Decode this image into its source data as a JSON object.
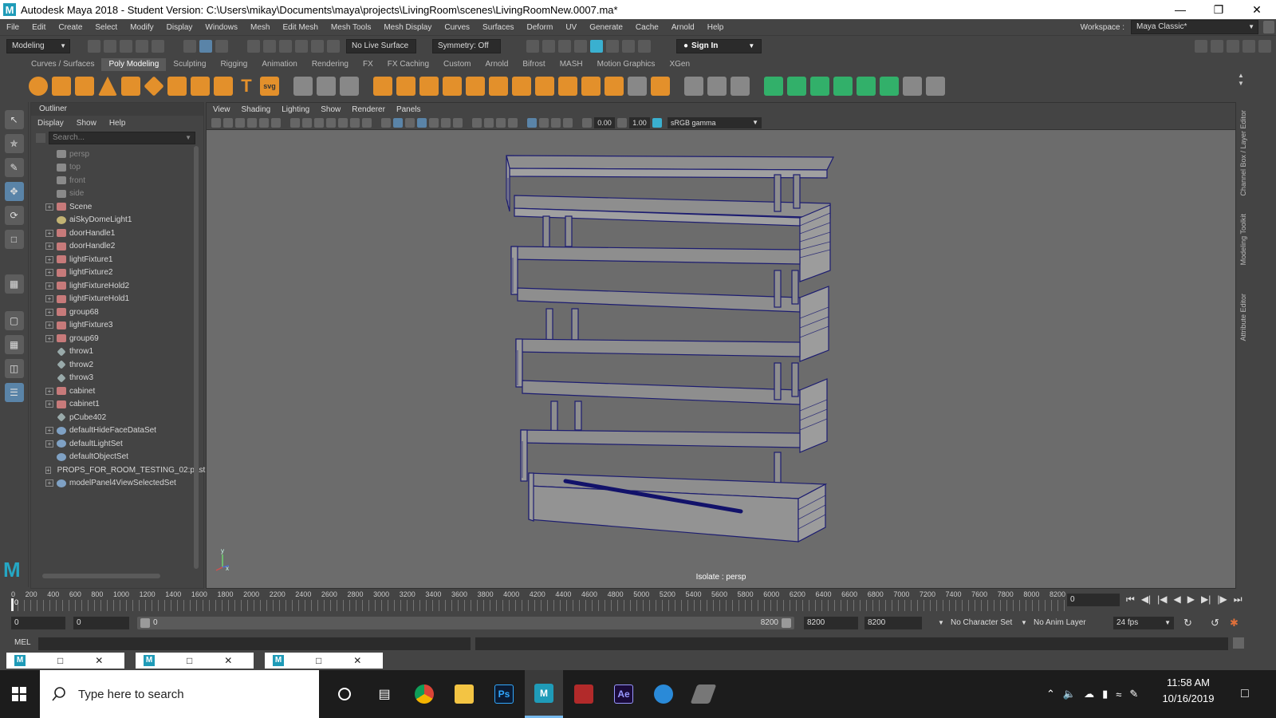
{
  "window": {
    "title": "Autodesk Maya 2018 - Student Version: C:\\Users\\mikay\\Documents\\maya\\projects\\LivingRoom\\scenes\\LivingRoomNew.0007.ma*",
    "logo": "M"
  },
  "menubar": [
    "File",
    "Edit",
    "Create",
    "Select",
    "Modify",
    "Display",
    "Windows",
    "Mesh",
    "Edit Mesh",
    "Mesh Tools",
    "Mesh Display",
    "Curves",
    "Surfaces",
    "Deform",
    "UV",
    "Generate",
    "Cache",
    "Arnold",
    "Help"
  ],
  "workspace": {
    "label": "Workspace :",
    "value": "Maya Classic*"
  },
  "statusline": {
    "menuset": "Modeling",
    "live_surface": "No Live Surface",
    "symmetry": "Symmetry: Off",
    "sign_in": "Sign In"
  },
  "shelf": {
    "tabs": [
      "Curves / Surfaces",
      "Poly Modeling",
      "Sculpting",
      "Rigging",
      "Animation",
      "Rendering",
      "FX",
      "FX Caching",
      "Custom",
      "Arnold",
      "Bifrost",
      "MASH",
      "Motion Graphics",
      "XGen"
    ],
    "active_tab": "Poly Modeling",
    "text_icons": {
      "type": "T",
      "svg": "svg"
    }
  },
  "outliner": {
    "title": "Outliner",
    "menu": [
      "Display",
      "Show",
      "Help"
    ],
    "search_placeholder": "Search...",
    "items": [
      {
        "name": "persp",
        "icon": "camera-icon",
        "expandable": false,
        "dim": true
      },
      {
        "name": "top",
        "icon": "camera-icon",
        "expandable": false,
        "dim": true
      },
      {
        "name": "front",
        "icon": "camera-icon",
        "expandable": false,
        "dim": true
      },
      {
        "name": "side",
        "icon": "camera-icon",
        "expandable": false,
        "dim": true
      },
      {
        "name": "Scene",
        "icon": "mesh-icon",
        "expandable": true,
        "dim": false
      },
      {
        "name": "aiSkyDomeLight1",
        "icon": "light-icon",
        "expandable": false,
        "dim": false
      },
      {
        "name": "doorHandle1",
        "icon": "mesh-icon",
        "expandable": true,
        "dim": false
      },
      {
        "name": "doorHandle2",
        "icon": "mesh-icon",
        "expandable": true,
        "dim": false
      },
      {
        "name": "lightFixture1",
        "icon": "mesh-icon",
        "expandable": true,
        "dim": false
      },
      {
        "name": "lightFixture2",
        "icon": "mesh-icon",
        "expandable": true,
        "dim": false
      },
      {
        "name": "lightFixtureHold2",
        "icon": "mesh-icon",
        "expandable": true,
        "dim": false
      },
      {
        "name": "lightFixtureHold1",
        "icon": "mesh-icon",
        "expandable": true,
        "dim": false
      },
      {
        "name": "group68",
        "icon": "mesh-icon",
        "expandable": true,
        "dim": false
      },
      {
        "name": "lightFixture3",
        "icon": "mesh-icon",
        "expandable": true,
        "dim": false
      },
      {
        "name": "group69",
        "icon": "mesh-icon",
        "expandable": true,
        "dim": false
      },
      {
        "name": "throw1",
        "icon": "object-icon",
        "expandable": false,
        "dim": false
      },
      {
        "name": "throw2",
        "icon": "object-icon",
        "expandable": false,
        "dim": false
      },
      {
        "name": "throw3",
        "icon": "object-icon",
        "expandable": false,
        "dim": false
      },
      {
        "name": "cabinet",
        "icon": "mesh-icon",
        "expandable": true,
        "dim": false
      },
      {
        "name": "cabinet1",
        "icon": "mesh-icon",
        "expandable": true,
        "dim": false
      },
      {
        "name": "pCube402",
        "icon": "object-icon",
        "expandable": false,
        "dim": false
      },
      {
        "name": "defaultHideFaceDataSet",
        "icon": "set-icon",
        "expandable": true,
        "dim": false
      },
      {
        "name": "defaultLightSet",
        "icon": "set-icon",
        "expandable": true,
        "dim": false
      },
      {
        "name": "defaultObjectSet",
        "icon": "set-icon",
        "expandable": false,
        "dim": false
      },
      {
        "name": "PROPS_FOR_ROOM_TESTING_02:past",
        "icon": "set-icon",
        "expandable": true,
        "dim": false
      },
      {
        "name": "modelPanel4ViewSelectedSet",
        "icon": "set-icon",
        "expandable": true,
        "dim": false
      }
    ]
  },
  "viewport": {
    "menu": [
      "View",
      "Shading",
      "Lighting",
      "Show",
      "Renderer",
      "Panels"
    ],
    "exposure": "0.00",
    "gamma": "1.00",
    "color_space": "sRGB gamma",
    "status": "Isolate : persp",
    "axis_y": "y",
    "axis_x": "x"
  },
  "right_rail": [
    "Channel Box / Layer Editor",
    "Modeling Toolkit",
    "Attribute Editor"
  ],
  "timeline": {
    "ticks": [
      "0",
      "200",
      "400",
      "600",
      "800",
      "1000",
      "1200",
      "1400",
      "1600",
      "1800",
      "2000",
      "2200",
      "2400",
      "2600",
      "2800",
      "3000",
      "3200",
      "3400",
      "3600",
      "3800",
      "4000",
      "4200",
      "4400",
      "4600",
      "4800",
      "5000",
      "5200",
      "5400",
      "5600",
      "5800",
      "6000",
      "6200",
      "6400",
      "6600",
      "6800",
      "7000",
      "7200",
      "7400",
      "7600",
      "7800",
      "8000",
      "8200"
    ],
    "current_frame": "0",
    "playhead_label": "0"
  },
  "range": {
    "start": "0",
    "anim_start": "0",
    "range_start": "0",
    "range_end": "8200",
    "anim_end": "8200",
    "end": "8200",
    "character_set": "No Character Set",
    "anim_layer": "No Anim Layer",
    "fps": "24 fps"
  },
  "command_line": {
    "mode": "MEL"
  },
  "taskbar": {
    "search_placeholder": "Type here to search",
    "time": "11:58 AM",
    "date": "10/16/2019"
  },
  "colors": {
    "accent": "#5a84a8",
    "maya_blue": "#1f9bb8",
    "shelf_orange": "#e3902b",
    "shelf_green": "#32b06a",
    "viewport_bg": "#6c6c6c",
    "wireframe": "#1a1a6e"
  }
}
